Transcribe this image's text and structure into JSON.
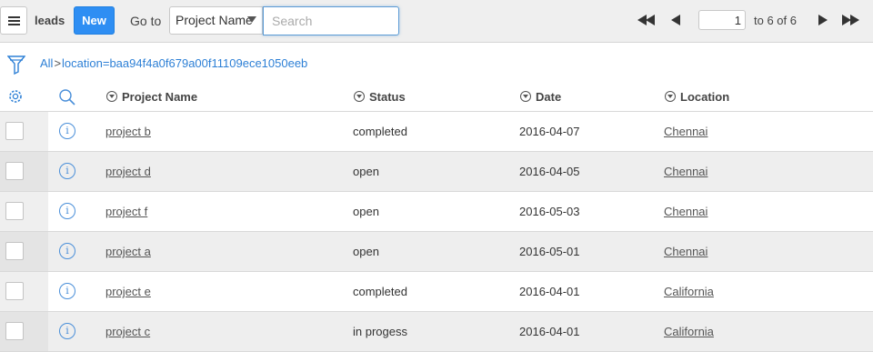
{
  "toolbar": {
    "menu_icon": "hamburger-icon",
    "app_name": "leads",
    "new_label": "New",
    "goto_label": "Go to",
    "field_select": "Project Name",
    "search_placeholder": "Search",
    "pager": {
      "first_icon": "first-page-icon",
      "prev_icon": "prev-page-icon",
      "next_icon": "next-page-icon",
      "last_icon": "last-page-icon",
      "page": "1",
      "range_text": "to 6 of 6"
    }
  },
  "filter": {
    "icon": "filter-icon",
    "crumb_all": "All",
    "crumb_sep": ">",
    "crumb_filter": "location=baa94f4a0f679a00f11109ece1050eeb"
  },
  "columns": {
    "settings_icon": "gear-icon",
    "search_icon": "search-icon",
    "project_name": "Project Name",
    "status": "Status",
    "date": "Date",
    "location": "Location"
  },
  "rows": [
    {
      "name": "project b",
      "status": "completed",
      "date": "2016-04-07",
      "location": "Chennai"
    },
    {
      "name": "project d",
      "status": "open",
      "date": "2016-04-05",
      "location": "Chennai"
    },
    {
      "name": "project f",
      "status": "open",
      "date": "2016-05-03",
      "location": "Chennai"
    },
    {
      "name": "project a",
      "status": "open",
      "date": "2016-05-01",
      "location": "Chennai"
    },
    {
      "name": "project e",
      "status": "completed",
      "date": "2016-04-01",
      "location": "California"
    },
    {
      "name": "project c",
      "status": "in progess",
      "date": "2016-04-01",
      "location": "California"
    }
  ],
  "colors": {
    "accent": "#2e8ef3",
    "link": "#2e80d6",
    "row_alt": "#eeeeee"
  }
}
